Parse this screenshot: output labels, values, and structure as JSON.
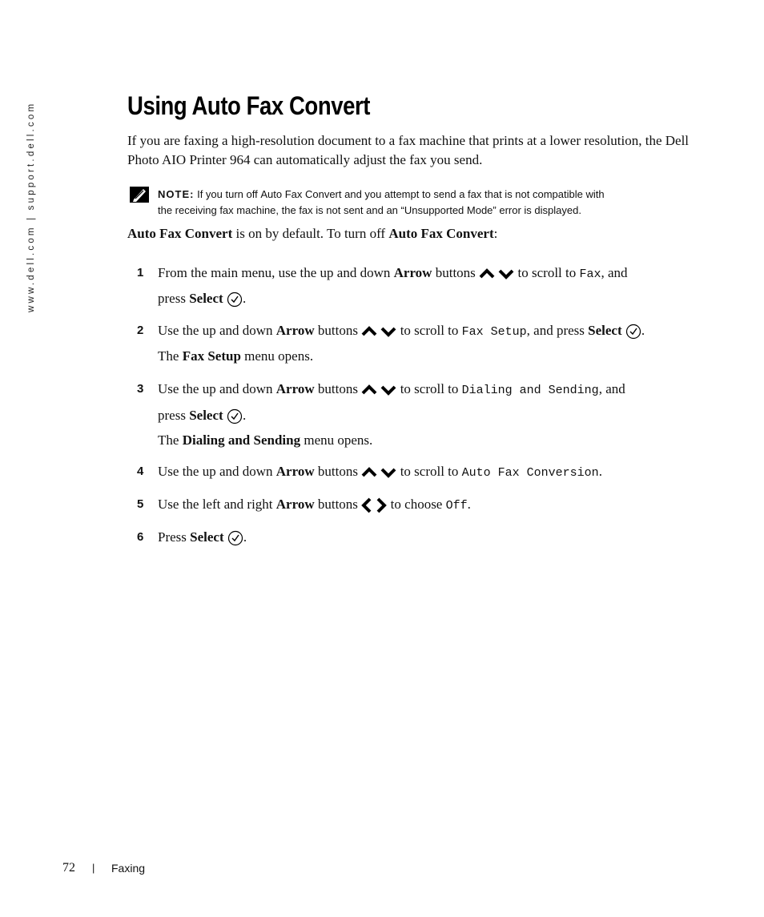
{
  "side_header": "www.dell.com | support.dell.com",
  "title": "Using Auto Fax Convert",
  "intro": "If you are faxing a high-resolution document to a fax machine that prints at a lower resolution, the Dell Photo AIO Printer 964 can automatically adjust the fax you send.",
  "note": {
    "label": "NOTE:",
    "pre": "If you turn off",
    "bold": "Auto Fax Convert",
    "post": "and you attempt to send a fax that is not compatible with",
    "line2": "the receiving fax machine, the fax is not sent and an “Unsupported Mode” error is displayed."
  },
  "lead": {
    "b1": "Auto Fax Convert",
    "mid": " is on by default. To turn off ",
    "b2": "Auto Fax Convert",
    "end": ":"
  },
  "steps": [
    {
      "num": "1",
      "a": "From the main menu, use the up and down ",
      "arrow": "Arrow",
      "b": " buttons",
      "c": " to scroll to ",
      "menu": "Fax",
      "d": ", and",
      "e": "press ",
      "select": "Select",
      "f": "."
    },
    {
      "num": "2",
      "a": "Use the up and down ",
      "arrow": "Arrow",
      "b": " buttons",
      "c": " to scroll to ",
      "menu": "Fax Setup",
      "d": ", and press ",
      "select": "Select",
      "f": ".",
      "sub_a": "The ",
      "sub_b": "Fax Setup",
      "sub_c": " menu opens."
    },
    {
      "num": "3",
      "a": "Use the up and down ",
      "arrow": "Arrow",
      "b": " buttons",
      "c": " to scroll to ",
      "menu": "Dialing and Sending",
      "d": ", and",
      "e": "press ",
      "select": "Select",
      "f": ".",
      "sub_a": "The ",
      "sub_b": "Dialing and Sending",
      "sub_c": " menu opens."
    },
    {
      "num": "4",
      "a": "Use the up and down ",
      "arrow": "Arrow",
      "b": " buttons",
      "c": " to scroll to ",
      "menu": "Auto Fax Conversion",
      "d": "."
    },
    {
      "num": "5",
      "a": "Use the left and right ",
      "arrow": "Arrow",
      "b": " buttons",
      "c": " to choose ",
      "menu": "Off",
      "d": "."
    },
    {
      "num": "6",
      "a": "Press ",
      "select": "Select",
      "f": "."
    }
  ],
  "footer": {
    "page": "72",
    "sep": "|",
    "section": "Faxing"
  }
}
